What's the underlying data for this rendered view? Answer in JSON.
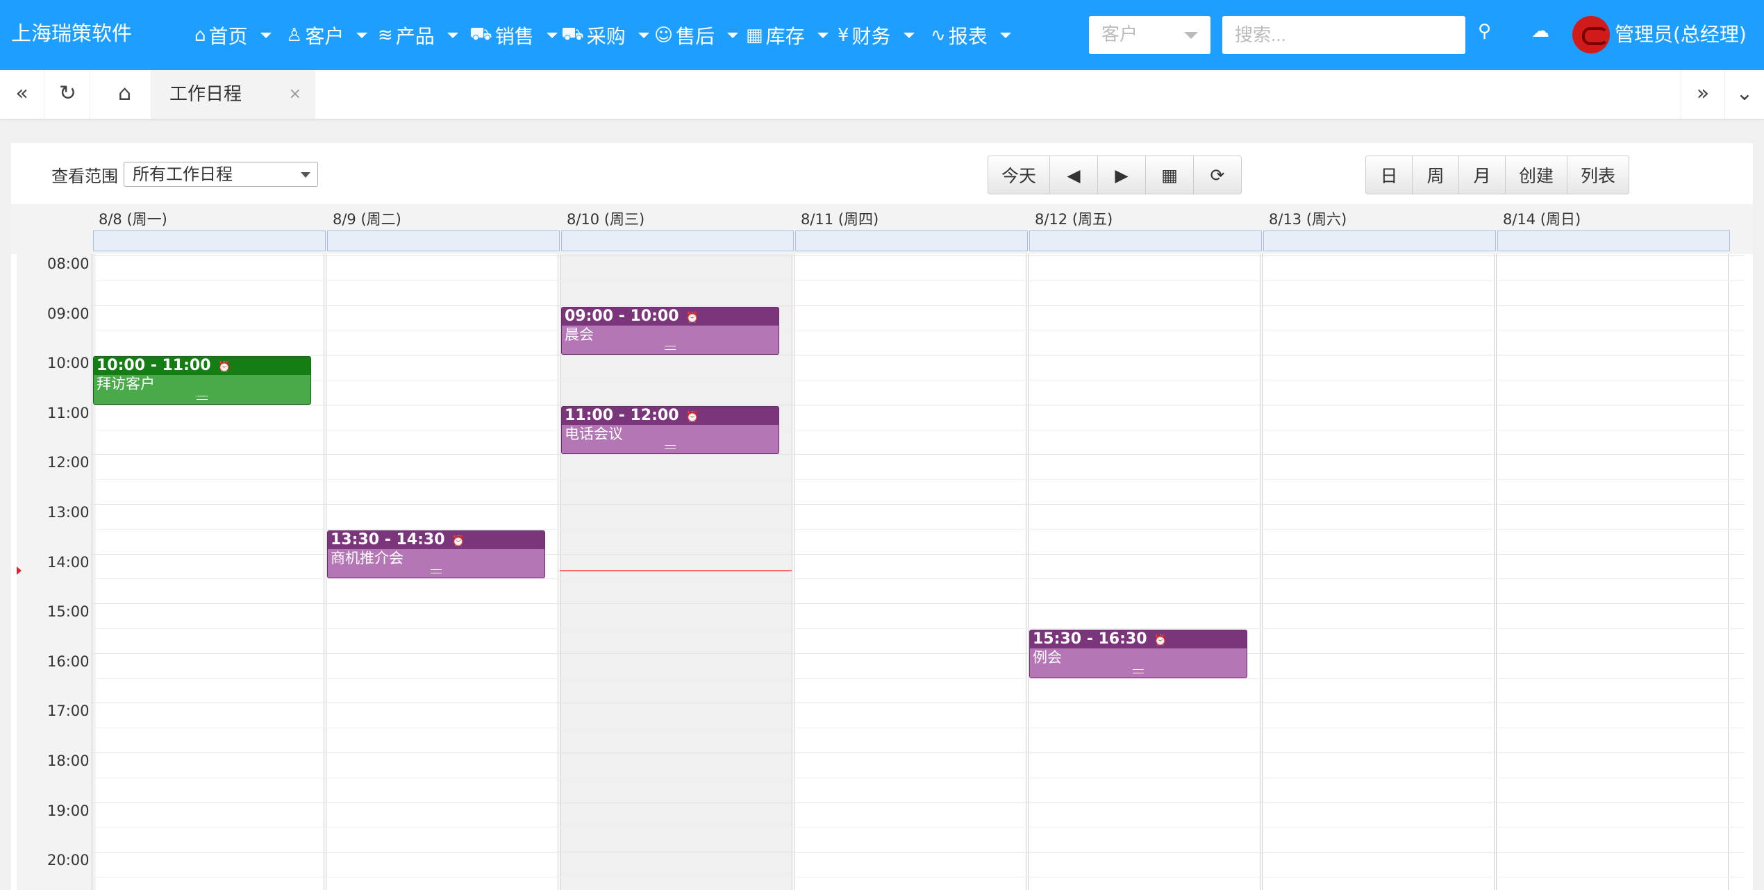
{
  "brand": "上海瑞策软件",
  "nav": [
    {
      "label": "首页",
      "icon": "home-icon"
    },
    {
      "label": "客户",
      "icon": "user-icon"
    },
    {
      "label": "产品",
      "icon": "layers-icon"
    },
    {
      "label": "销售",
      "icon": "cart-icon"
    },
    {
      "label": "采购",
      "icon": "cart-icon"
    },
    {
      "label": "售后",
      "icon": "smile-icon"
    },
    {
      "label": "库存",
      "icon": "calendar-icon"
    },
    {
      "label": "财务",
      "icon": "yen-icon"
    },
    {
      "label": "报表",
      "icon": "pulse-icon"
    }
  ],
  "search": {
    "type_value": "客户",
    "placeholder": "搜索..."
  },
  "user": {
    "name": "管理员(总经理)"
  },
  "tabs": {
    "active_label": "工作日程",
    "close_glyph": "×"
  },
  "toolbar": {
    "scope_label": "查看范围",
    "scope_value": "所有工作日程",
    "today": "今天",
    "views": [
      "日",
      "周",
      "月",
      "创建",
      "列表"
    ]
  },
  "calendar": {
    "days": [
      "8/8 (周一)",
      "8/9 (周二)",
      "8/10 (周三)",
      "8/11 (周四)",
      "8/12 (周五)",
      "8/13 (周六)",
      "8/14 (周日)"
    ],
    "today_index": 2,
    "times": [
      "08:00",
      "09:00",
      "10:00",
      "11:00",
      "12:00",
      "13:00",
      "14:00",
      "15:00",
      "16:00",
      "17:00",
      "18:00",
      "19:00",
      "20:00"
    ],
    "events": [
      {
        "day": 0,
        "time": "10:00 - 11:00",
        "title": "拜访客户",
        "color": "#4aaa4a"
      },
      {
        "day": 2,
        "time": "09:00 - 10:00",
        "title": "晨会",
        "color": "#b576b5"
      },
      {
        "day": 2,
        "time": "11:00 - 12:00",
        "title": "电话会议",
        "color": "#b576b5"
      },
      {
        "day": 1,
        "time": "13:30 - 14:30",
        "title": "商机推介会",
        "color": "#b576b5"
      },
      {
        "day": 4,
        "time": "15:30 - 16:30",
        "title": "例会",
        "color": "#b576b5"
      }
    ],
    "current_time": "14:20"
  },
  "colors": {
    "topbar": "#1e9fff",
    "event_green": "#4aaa4a",
    "event_purple": "#b576b5",
    "now_line": "#ff6a6a"
  }
}
